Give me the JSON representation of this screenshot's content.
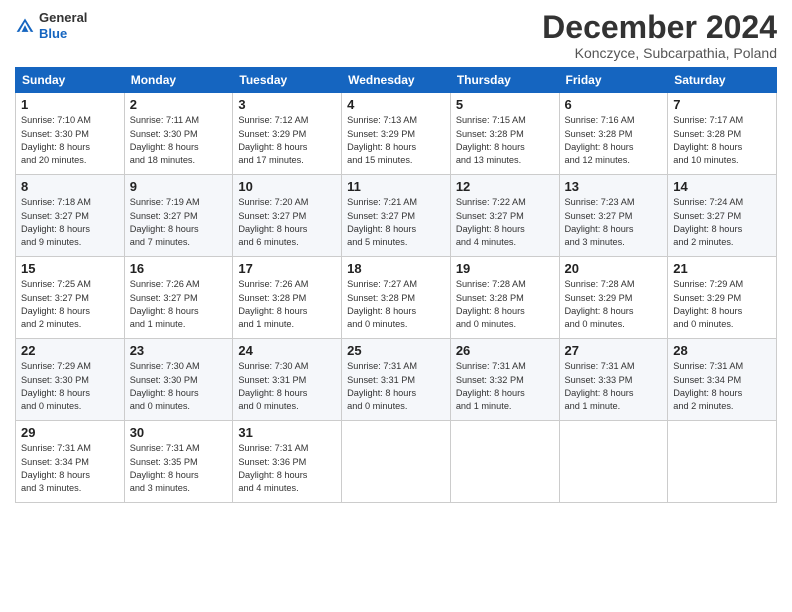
{
  "header": {
    "logo_line1": "General",
    "logo_line2": "Blue",
    "month": "December 2024",
    "location": "Konczyce, Subcarpathia, Poland"
  },
  "weekdays": [
    "Sunday",
    "Monday",
    "Tuesday",
    "Wednesday",
    "Thursday",
    "Friday",
    "Saturday"
  ],
  "weeks": [
    [
      {
        "day": "1",
        "info": "Sunrise: 7:10 AM\nSunset: 3:30 PM\nDaylight: 8 hours\nand 20 minutes."
      },
      {
        "day": "2",
        "info": "Sunrise: 7:11 AM\nSunset: 3:30 PM\nDaylight: 8 hours\nand 18 minutes."
      },
      {
        "day": "3",
        "info": "Sunrise: 7:12 AM\nSunset: 3:29 PM\nDaylight: 8 hours\nand 17 minutes."
      },
      {
        "day": "4",
        "info": "Sunrise: 7:13 AM\nSunset: 3:29 PM\nDaylight: 8 hours\nand 15 minutes."
      },
      {
        "day": "5",
        "info": "Sunrise: 7:15 AM\nSunset: 3:28 PM\nDaylight: 8 hours\nand 13 minutes."
      },
      {
        "day": "6",
        "info": "Sunrise: 7:16 AM\nSunset: 3:28 PM\nDaylight: 8 hours\nand 12 minutes."
      },
      {
        "day": "7",
        "info": "Sunrise: 7:17 AM\nSunset: 3:28 PM\nDaylight: 8 hours\nand 10 minutes."
      }
    ],
    [
      {
        "day": "8",
        "info": "Sunrise: 7:18 AM\nSunset: 3:27 PM\nDaylight: 8 hours\nand 9 minutes."
      },
      {
        "day": "9",
        "info": "Sunrise: 7:19 AM\nSunset: 3:27 PM\nDaylight: 8 hours\nand 7 minutes."
      },
      {
        "day": "10",
        "info": "Sunrise: 7:20 AM\nSunset: 3:27 PM\nDaylight: 8 hours\nand 6 minutes."
      },
      {
        "day": "11",
        "info": "Sunrise: 7:21 AM\nSunset: 3:27 PM\nDaylight: 8 hours\nand 5 minutes."
      },
      {
        "day": "12",
        "info": "Sunrise: 7:22 AM\nSunset: 3:27 PM\nDaylight: 8 hours\nand 4 minutes."
      },
      {
        "day": "13",
        "info": "Sunrise: 7:23 AM\nSunset: 3:27 PM\nDaylight: 8 hours\nand 3 minutes."
      },
      {
        "day": "14",
        "info": "Sunrise: 7:24 AM\nSunset: 3:27 PM\nDaylight: 8 hours\nand 2 minutes."
      }
    ],
    [
      {
        "day": "15",
        "info": "Sunrise: 7:25 AM\nSunset: 3:27 PM\nDaylight: 8 hours\nand 2 minutes."
      },
      {
        "day": "16",
        "info": "Sunrise: 7:26 AM\nSunset: 3:27 PM\nDaylight: 8 hours\nand 1 minute."
      },
      {
        "day": "17",
        "info": "Sunrise: 7:26 AM\nSunset: 3:28 PM\nDaylight: 8 hours\nand 1 minute."
      },
      {
        "day": "18",
        "info": "Sunrise: 7:27 AM\nSunset: 3:28 PM\nDaylight: 8 hours\nand 0 minutes."
      },
      {
        "day": "19",
        "info": "Sunrise: 7:28 AM\nSunset: 3:28 PM\nDaylight: 8 hours\nand 0 minutes."
      },
      {
        "day": "20",
        "info": "Sunrise: 7:28 AM\nSunset: 3:29 PM\nDaylight: 8 hours\nand 0 minutes."
      },
      {
        "day": "21",
        "info": "Sunrise: 7:29 AM\nSunset: 3:29 PM\nDaylight: 8 hours\nand 0 minutes."
      }
    ],
    [
      {
        "day": "22",
        "info": "Sunrise: 7:29 AM\nSunset: 3:30 PM\nDaylight: 8 hours\nand 0 minutes."
      },
      {
        "day": "23",
        "info": "Sunrise: 7:30 AM\nSunset: 3:30 PM\nDaylight: 8 hours\nand 0 minutes."
      },
      {
        "day": "24",
        "info": "Sunrise: 7:30 AM\nSunset: 3:31 PM\nDaylight: 8 hours\nand 0 minutes."
      },
      {
        "day": "25",
        "info": "Sunrise: 7:31 AM\nSunset: 3:31 PM\nDaylight: 8 hours\nand 0 minutes."
      },
      {
        "day": "26",
        "info": "Sunrise: 7:31 AM\nSunset: 3:32 PM\nDaylight: 8 hours\nand 1 minute."
      },
      {
        "day": "27",
        "info": "Sunrise: 7:31 AM\nSunset: 3:33 PM\nDaylight: 8 hours\nand 1 minute."
      },
      {
        "day": "28",
        "info": "Sunrise: 7:31 AM\nSunset: 3:34 PM\nDaylight: 8 hours\nand 2 minutes."
      }
    ],
    [
      {
        "day": "29",
        "info": "Sunrise: 7:31 AM\nSunset: 3:34 PM\nDaylight: 8 hours\nand 3 minutes."
      },
      {
        "day": "30",
        "info": "Sunrise: 7:31 AM\nSunset: 3:35 PM\nDaylight: 8 hours\nand 3 minutes."
      },
      {
        "day": "31",
        "info": "Sunrise: 7:31 AM\nSunset: 3:36 PM\nDaylight: 8 hours\nand 4 minutes."
      },
      null,
      null,
      null,
      null
    ]
  ]
}
